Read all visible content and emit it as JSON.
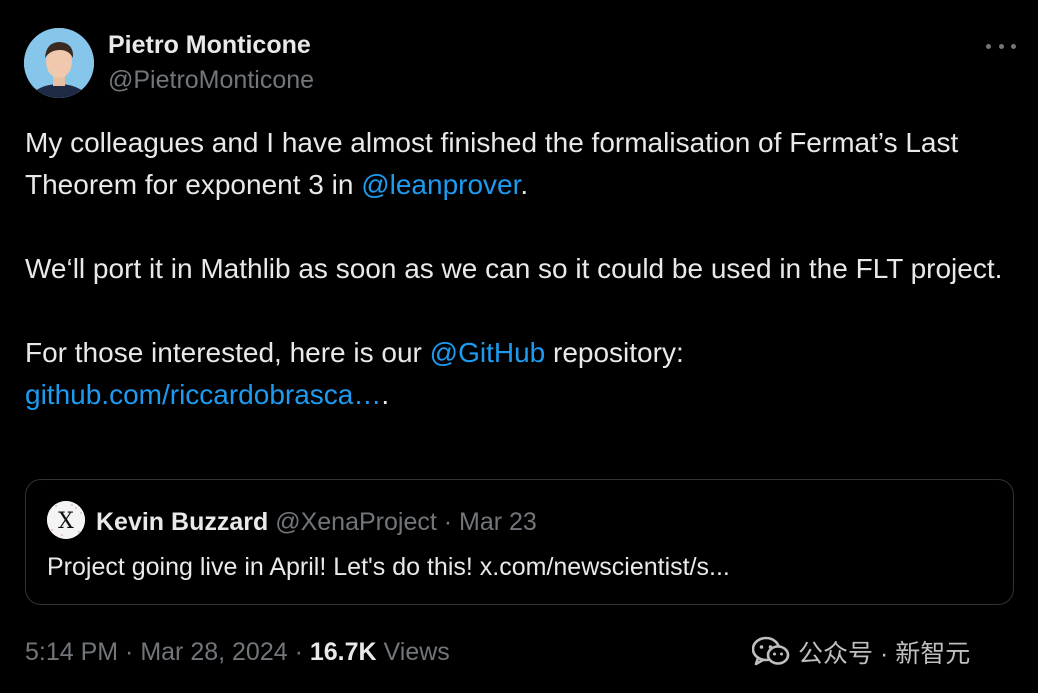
{
  "author": {
    "display_name": "Pietro Monticone",
    "handle": "@PietroMonticone"
  },
  "tweet": {
    "line1_pre": "My colleagues and I have almost finished the formalisation of Fermat’s Last Theorem for exponent 3 in ",
    "mention_lean": "@leanprover",
    "line1_post": ".",
    "para2": "We‘ll port it in Mathlib as soon as we can so it could be used in the FLT project.",
    "para3_pre": "For those interested, here is our ",
    "mention_github": "@GitHub",
    "para3_post": " repository: ",
    "repo_link": "github.com/riccardobrasca…",
    "para3_end": "."
  },
  "quote": {
    "avatar_letter": "X",
    "name": "Kevin Buzzard",
    "handle": "@XenaProject",
    "separator": " · ",
    "date": "Mar 23",
    "text": "Project going live in April! Let's do this! x.com/newscientist/s..."
  },
  "meta": {
    "time": "5:14 PM",
    "separator": " · ",
    "date": "Mar 28, 2024",
    "separator2": " · ",
    "views_count": "16.7K",
    "views_label": " Views"
  },
  "watermark": {
    "text": "公众号 · 新智元"
  },
  "colors": {
    "background": "#000000",
    "text": "#e7e9ea",
    "muted": "#71767b",
    "link": "#1d9bf0",
    "border": "#2f3336"
  },
  "icons": {
    "more": "more-horizontal-icon",
    "wechat": "wechat-icon"
  }
}
